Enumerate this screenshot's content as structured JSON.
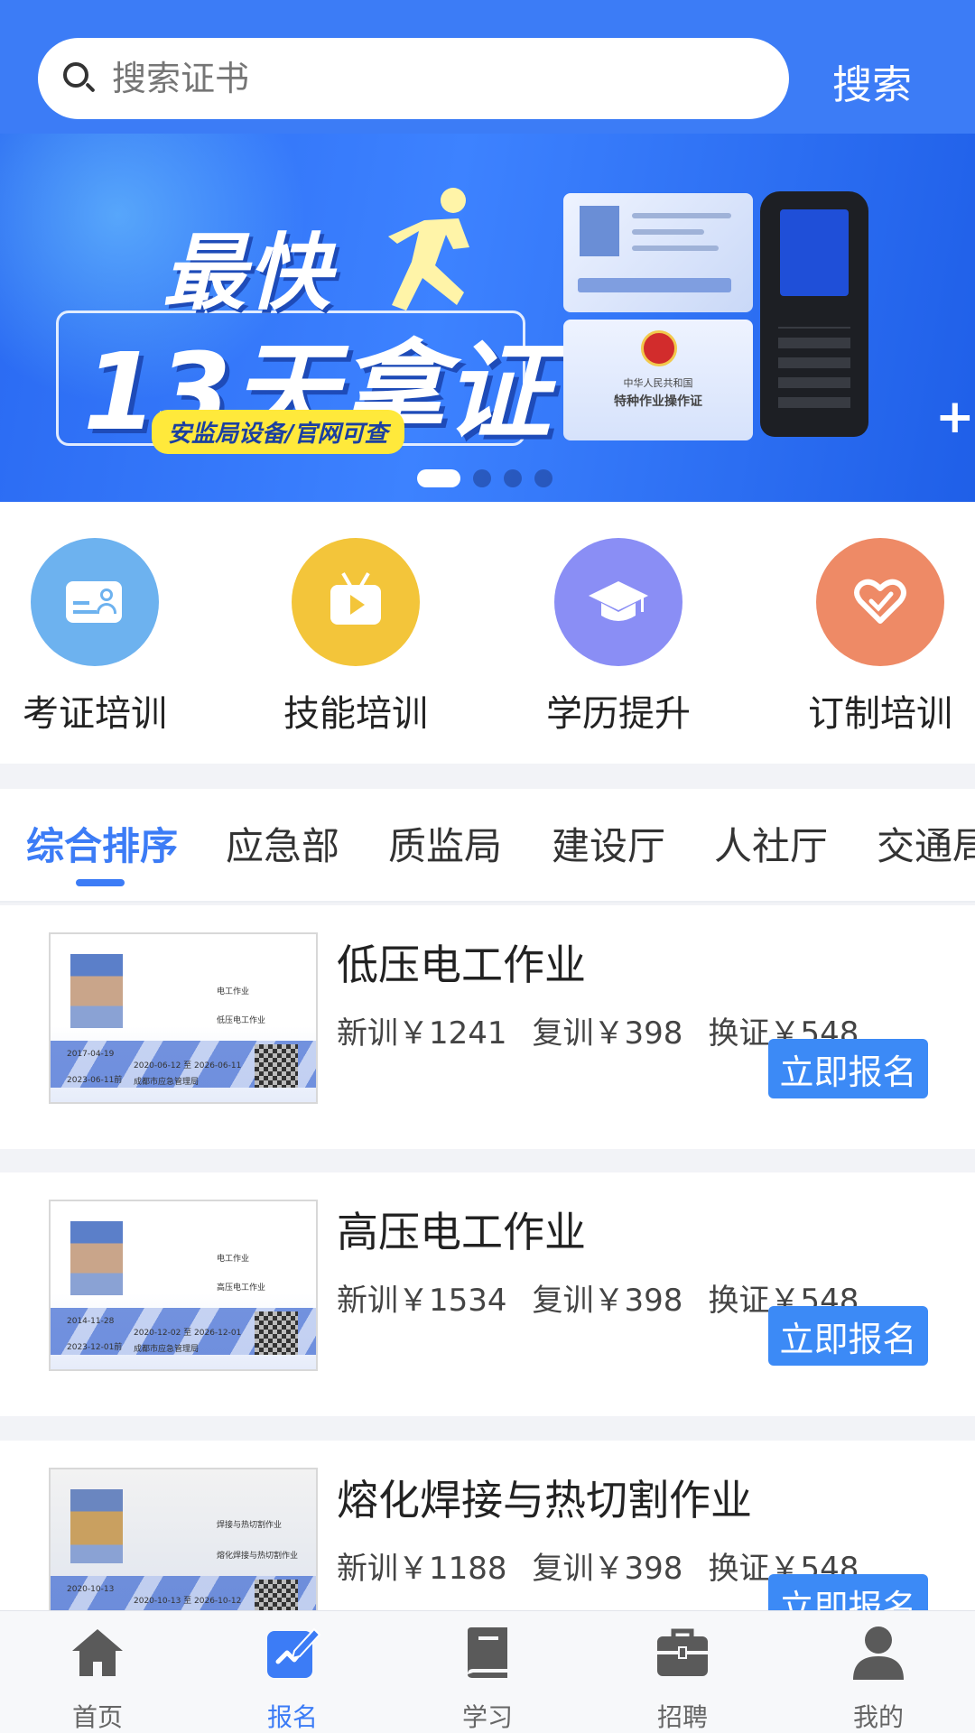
{
  "search": {
    "placeholder": "搜索证书",
    "button_label": "搜索"
  },
  "banner": {
    "headline_1": "最快",
    "headline_2": "13天拿证",
    "subtitle": "安监局设备/官网可查",
    "cert_text": "中华人民共和国",
    "cert_title": "特种作业操作证",
    "dots": 4,
    "active_dot": 1
  },
  "categories": [
    {
      "label": "考证培训",
      "icon": "id-card-icon",
      "color": "#6db2ef"
    },
    {
      "label": "技能培训",
      "icon": "tv-play-icon",
      "color": "#f3c53a"
    },
    {
      "label": "学历提升",
      "icon": "graduation-cap-icon",
      "color": "#8a8ef5"
    },
    {
      "label": "订制培训",
      "icon": "heart-badge-icon",
      "color": "#ee8a66"
    }
  ],
  "tabs": [
    "综合排序",
    "应急部",
    "质监局",
    "建设厅",
    "人社厅",
    "交通局"
  ],
  "active_tab": 0,
  "courses": [
    {
      "title": "低压电工作业",
      "new_price": "新训￥1241",
      "review_price": "复训￥398",
      "renew_price": "换证￥548",
      "button": "立即报名",
      "card": {
        "type": "电工作业",
        "item": "低压电工作业",
        "first": "2017-04-19",
        "valid": "2020-06-12 至 2026-06-11",
        "review": "2023-06-11前",
        "org": "成都市应急管理局"
      }
    },
    {
      "title": "高压电工作业",
      "new_price": "新训￥1534",
      "review_price": "复训￥398",
      "renew_price": "换证￥548",
      "button": "立即报名",
      "card": {
        "type": "电工作业",
        "item": "高压电工作业",
        "first": "2014-11-28",
        "valid": "2020-12-02 至 2026-12-01",
        "review": "2023-12-01前",
        "org": "成都市应急管理局"
      }
    },
    {
      "title": "熔化焊接与热切割作业",
      "new_price": "新训￥1188",
      "review_price": "复训￥398",
      "renew_price": "换证￥548",
      "button": "立即报名",
      "card": {
        "type": "焊接与热切割作业",
        "item": "熔化焊接与热切割作业",
        "first": "2020-10-13",
        "valid": "2020-10-13 至 2026-10-12",
        "review": "",
        "org": ""
      }
    }
  ],
  "bottom_nav": [
    {
      "label": "首页",
      "icon": "home-icon"
    },
    {
      "label": "报名",
      "icon": "edit-icon"
    },
    {
      "label": "学习",
      "icon": "book-icon"
    },
    {
      "label": "招聘",
      "icon": "briefcase-icon"
    },
    {
      "label": "我的",
      "icon": "user-icon"
    }
  ],
  "active_nav": 1,
  "colors": {
    "primary": "#3c7cf6",
    "enroll_button": "#3c8af6"
  }
}
